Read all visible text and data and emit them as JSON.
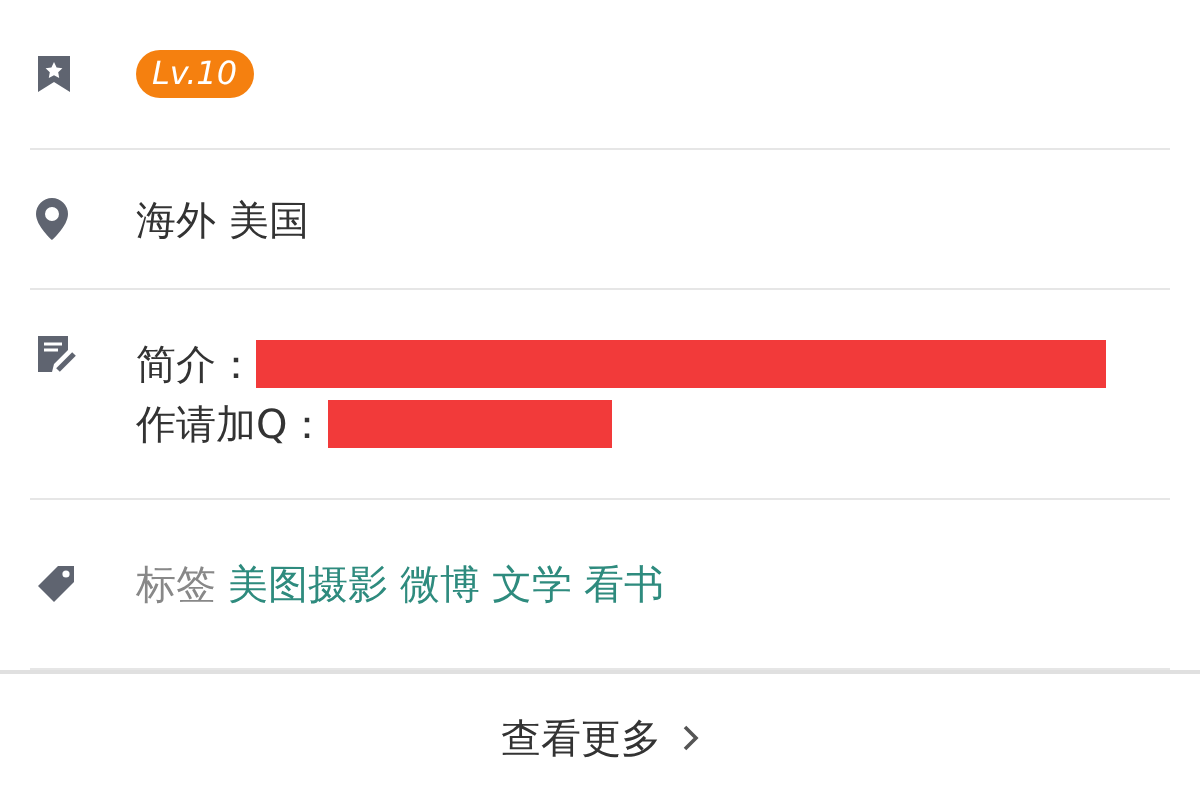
{
  "level_row": {
    "badge": "Lv.10"
  },
  "location_row": {
    "text": "海外 美国"
  },
  "intro_row": {
    "lines": [
      {
        "label": "简介："
      },
      {
        "label": "作请加Q："
      }
    ]
  },
  "tags_row": {
    "label": "标签",
    "tags": [
      "美图摄影",
      "微博",
      "文学",
      "看书"
    ]
  },
  "more_link": {
    "text": "查看更多"
  }
}
